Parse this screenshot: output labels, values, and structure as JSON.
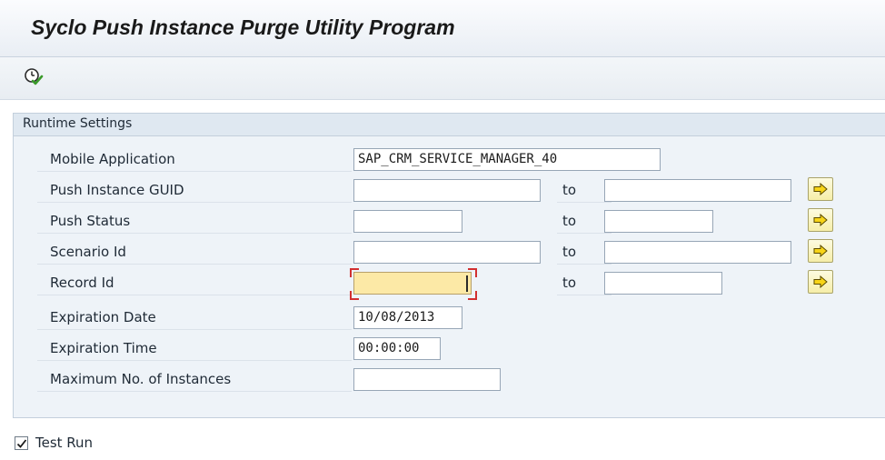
{
  "title": "Syclo Push Instance Purge Utility Program",
  "toolbar": {
    "execute_icon": "execute-clock-icon"
  },
  "group": {
    "title": "Runtime Settings"
  },
  "fields": {
    "mobile_application": {
      "label": "Mobile Application",
      "value": "SAP_CRM_SERVICE_MANAGER_40"
    },
    "push_instance_guid": {
      "label": "Push Instance GUID",
      "to_label": "to",
      "low": "",
      "high": ""
    },
    "push_status": {
      "label": "Push Status",
      "to_label": "to",
      "low": "",
      "high": ""
    },
    "scenario_id": {
      "label": "Scenario Id",
      "to_label": "to",
      "low": "",
      "high": ""
    },
    "record_id": {
      "label": "Record Id",
      "to_label": "to",
      "low": "",
      "high": ""
    },
    "expiration_date": {
      "label": "Expiration Date",
      "value": "10/08/2013"
    },
    "expiration_time": {
      "label": "Expiration Time",
      "value": "00:00:00"
    },
    "max_instances": {
      "label": "Maximum No. of Instances",
      "value": ""
    }
  },
  "test_run": {
    "label": "Test Run",
    "checked": true
  },
  "colors": {
    "active_field": "#fce9a6",
    "focus_border": "#d23030",
    "multi_select_button": "#f6eea8",
    "group_background": "#eef3f8"
  }
}
